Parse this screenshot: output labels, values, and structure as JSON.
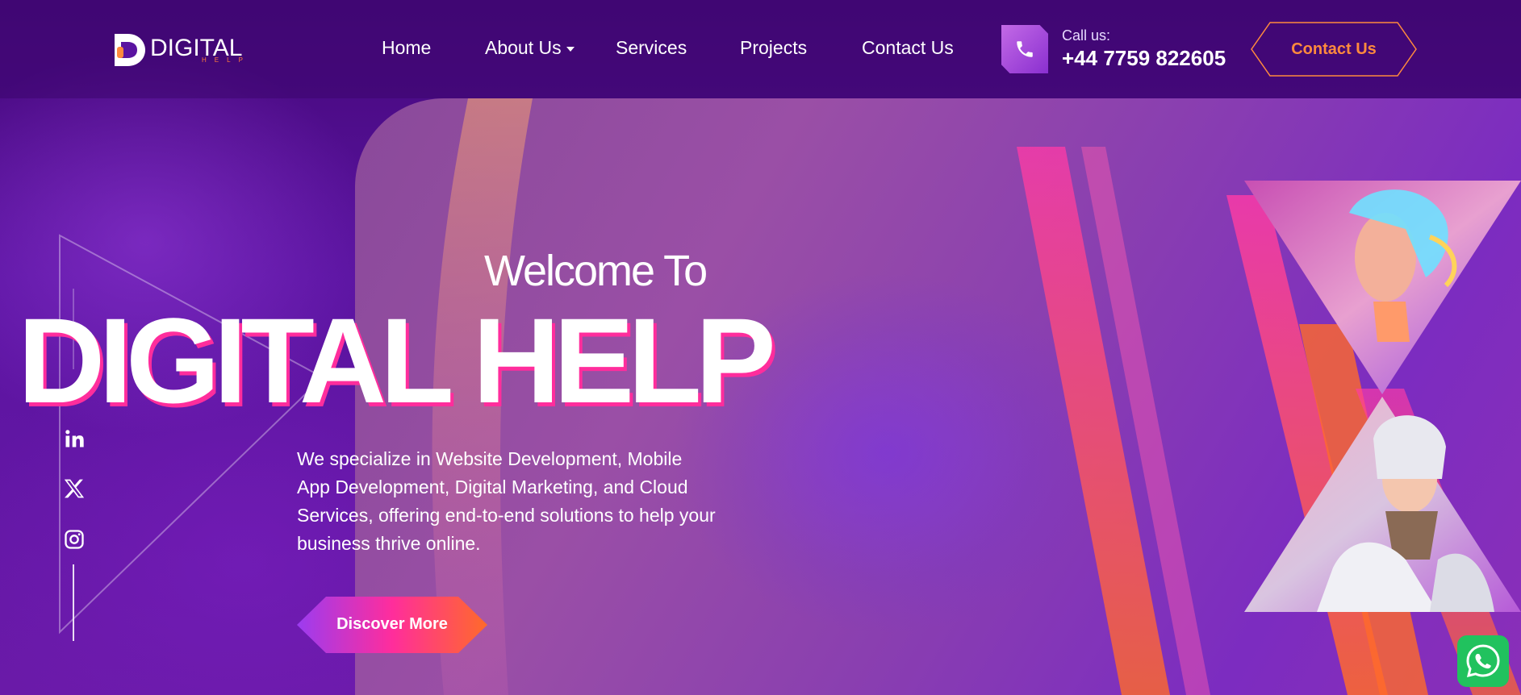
{
  "brand": {
    "logo_word": "DIGITAL",
    "logo_sub": "HELP"
  },
  "nav": {
    "items": [
      {
        "label": "Home"
      },
      {
        "label": "About Us",
        "has_dropdown": true
      },
      {
        "label": "Services"
      },
      {
        "label": "Projects"
      },
      {
        "label": "Contact Us"
      }
    ]
  },
  "header_contact": {
    "call_label": "Call us:",
    "phone": "+44 7759 822605",
    "button_label": "Contact Us"
  },
  "hero": {
    "welcome": "Welcome To",
    "title": "DIGITAL HELP",
    "description": "We specialize in Website Development, Mobile App Development, Digital Marketing, and Cloud Services, offering end-to-end solutions to help your business thrive online.",
    "cta_label": "Discover More"
  },
  "social": {
    "items": [
      {
        "icon": "linkedin-icon"
      },
      {
        "icon": "x-icon"
      },
      {
        "icon": "instagram-icon"
      }
    ]
  },
  "floating": {
    "icon": "whatsapp-icon"
  },
  "colors": {
    "accent_orange": "#ff8a3d",
    "accent_pink": "#ff2d9c",
    "accent_purple": "#9b3cf0",
    "whatsapp_green": "#21c25e"
  }
}
